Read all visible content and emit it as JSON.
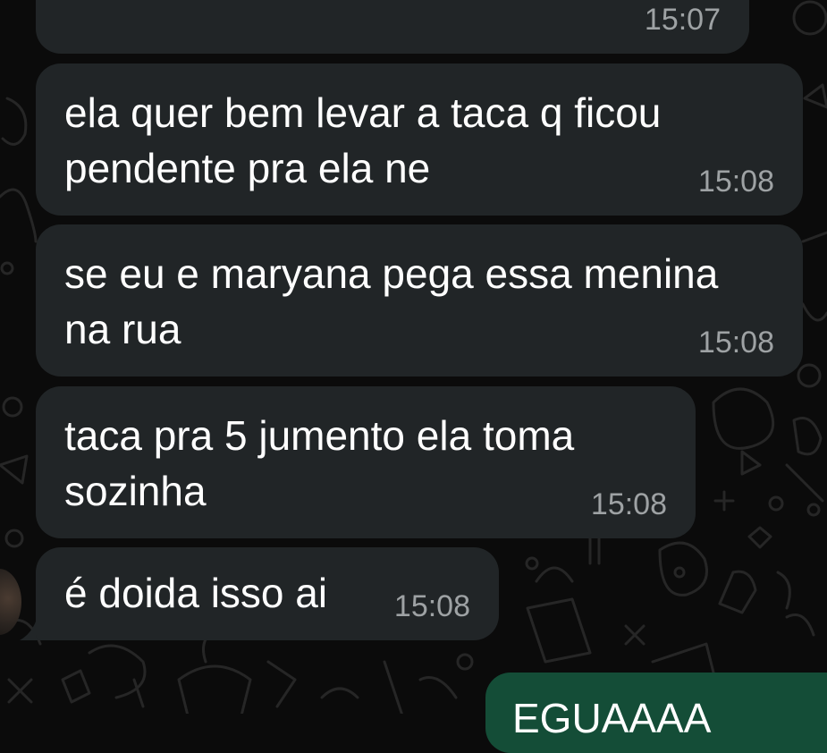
{
  "messages": [
    {
      "text": "",
      "time": "15:07",
      "direction": "incoming"
    },
    {
      "text": "ela quer bem levar a taca q ficou\npendente pra ela ne",
      "time": "15:08",
      "direction": "incoming"
    },
    {
      "text": "se eu e maryana pega essa menina\nna rua",
      "time": "15:08",
      "direction": "incoming"
    },
    {
      "text": "taca pra 5 jumento ela toma\nsozinha",
      "time": "15:08",
      "direction": "incoming"
    },
    {
      "text": "é doida isso ai",
      "time": "15:08",
      "direction": "incoming"
    }
  ],
  "sent_message": {
    "text": "EGUAAAA"
  },
  "colors": {
    "background": "#0b0b0b",
    "incoming_bubble": "#212527",
    "outgoing_bubble": "#144d37",
    "timestamp": "#9ea2a4",
    "text": "#ffffff"
  }
}
